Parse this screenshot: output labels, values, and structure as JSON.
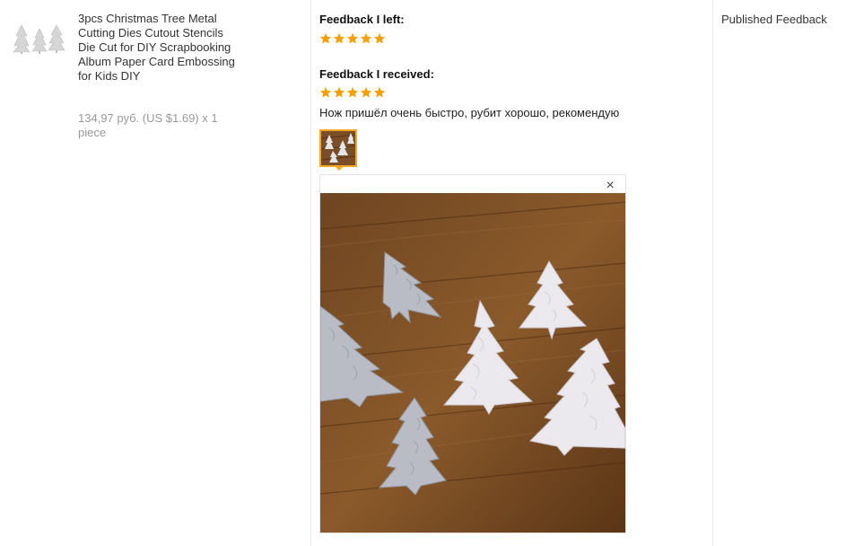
{
  "product": {
    "title": "3pcs Christmas Tree Metal Cutting Dies Cutout Stencils Die Cut for DIY Scrapbooking Album Paper Card Embossing for Kids DIY",
    "price": "134,97 руб. (US $1.69) x 1 piece",
    "thumbnail_icon": "christmas-tree-dies-icon"
  },
  "feedback": {
    "left_label": "Feedback I left:",
    "left_rating": 5,
    "received_label": "Feedback I received:",
    "received_rating": 5,
    "comment": "Нож пришёл очень быстро, рубит хорошо, рекомендую",
    "star_color": "#f5a000",
    "thumb_border_color": "#f5a623",
    "photo_description_icon": "christmas-tree-dies-photo",
    "close_glyph": "×"
  },
  "status": {
    "label": "Published Feedback"
  }
}
